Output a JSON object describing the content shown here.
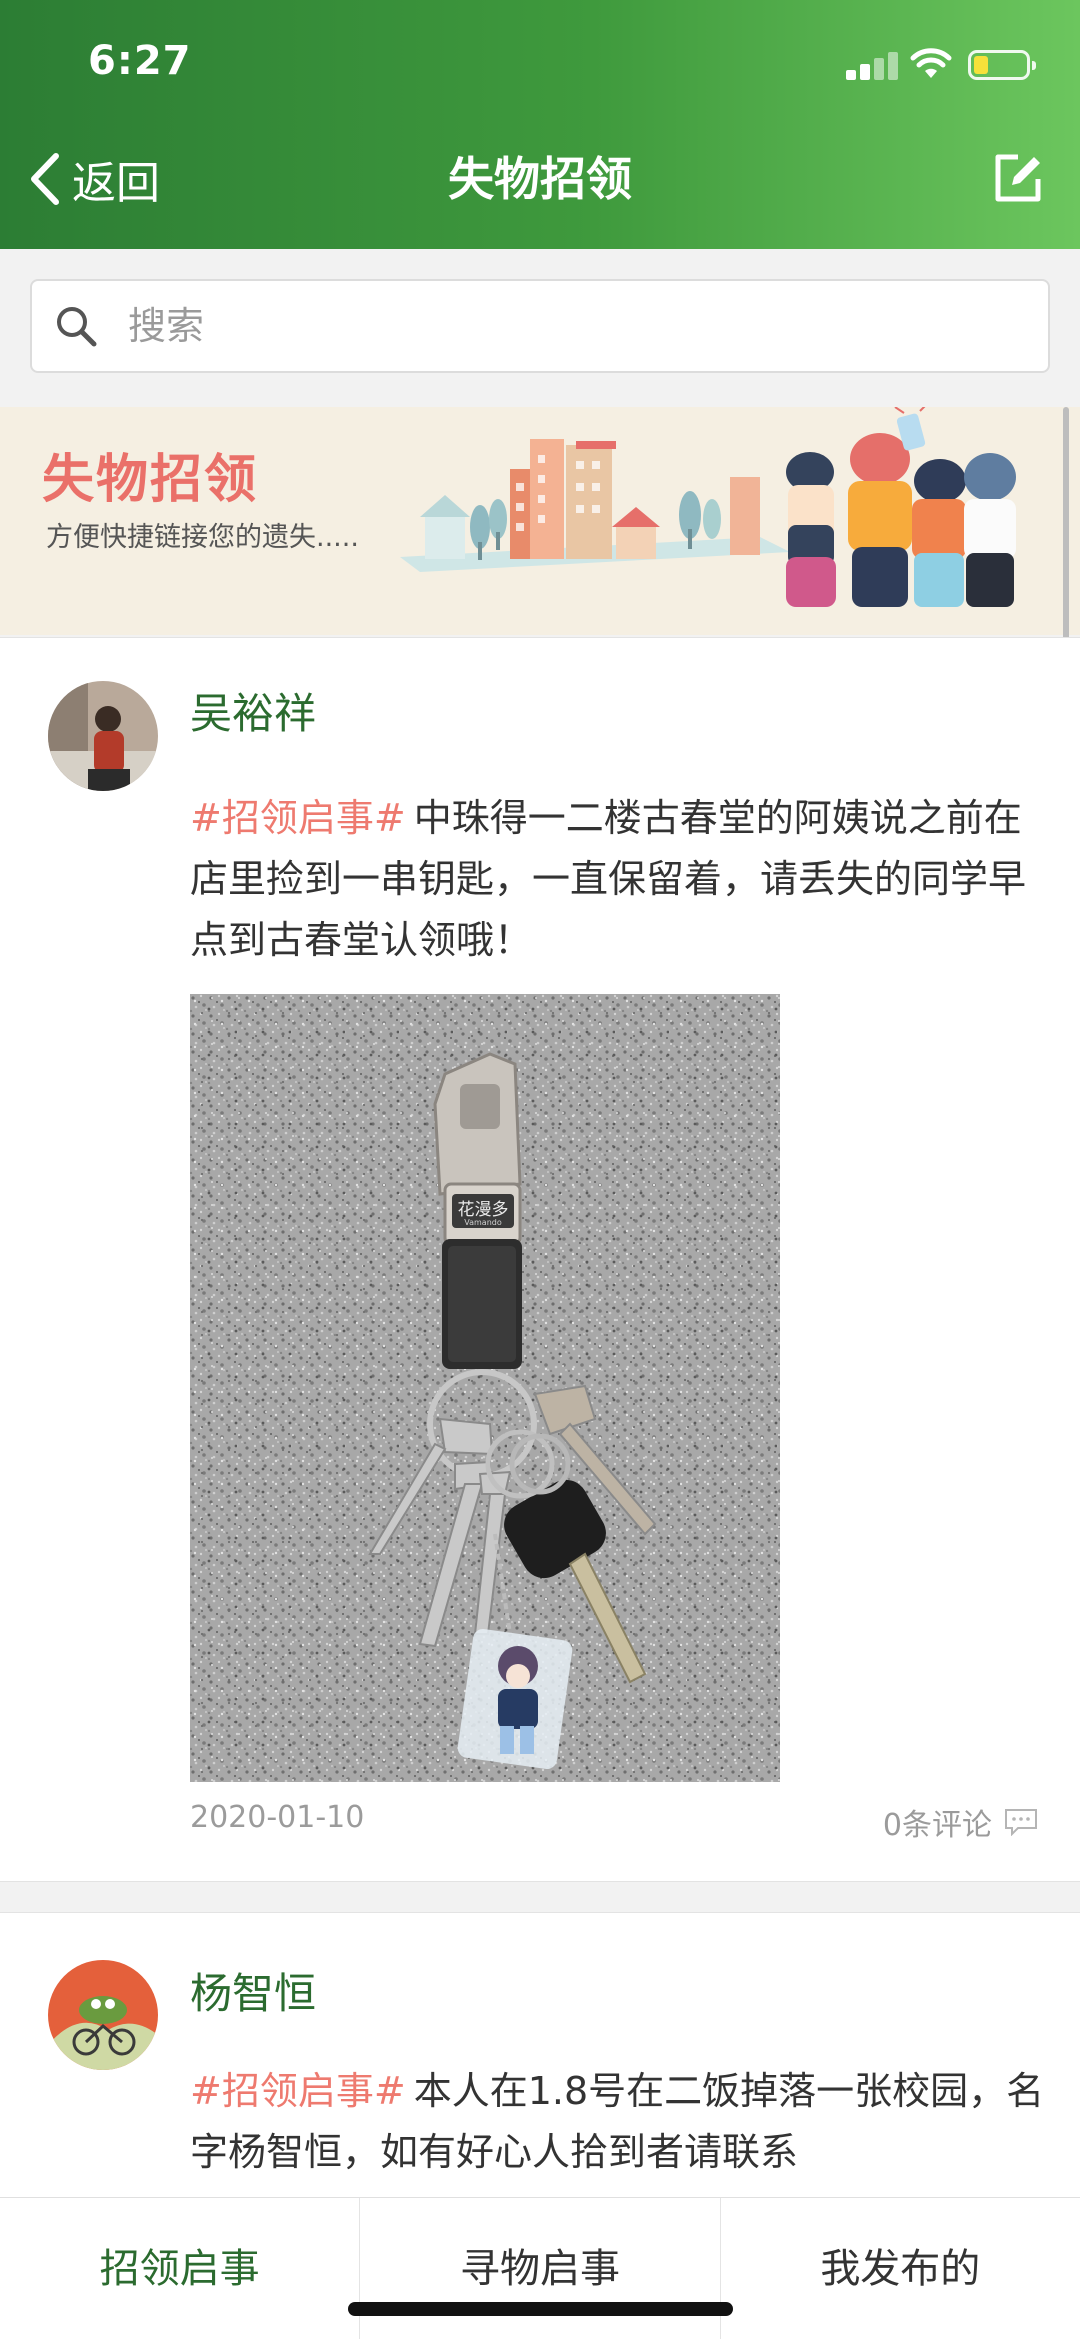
{
  "status_bar": {
    "time": "6:27"
  },
  "nav": {
    "back_label": "返回",
    "title": "失物招领"
  },
  "search": {
    "placeholder": "搜索"
  },
  "banner": {
    "title": "失物招领",
    "subtitle": "方便快捷链接您的遗失....."
  },
  "posts": [
    {
      "author": "吴裕祥",
      "tag": "#招领启事#",
      "text": "中珠得一二楼古春堂的阿姨说之前在店里捡到一串钥匙，一直保留着，请丢失的同学早点到古春堂认领哦！",
      "keychain_brand": "花漫多",
      "keychain_brand_sub": "Vamando",
      "date": "2020-01-10",
      "comments": "0条评论"
    },
    {
      "author": "杨智恒",
      "tag": "#招领启事#",
      "text": "本人在1.8号在二饭掉落一张校园，名字杨智恒，如有好心人拾到者请联系"
    }
  ],
  "tabs": [
    {
      "label": "招领启事",
      "active": true
    },
    {
      "label": "寻物启事",
      "active": false
    },
    {
      "label": "我发布的",
      "active": false
    }
  ],
  "colors": {
    "header_start": "#2c7d34",
    "header_end": "#6cc65e",
    "accent_green": "#2b6b2f",
    "tag_pink": "#ee7a6f",
    "banner_bg": "#f5efe2"
  }
}
